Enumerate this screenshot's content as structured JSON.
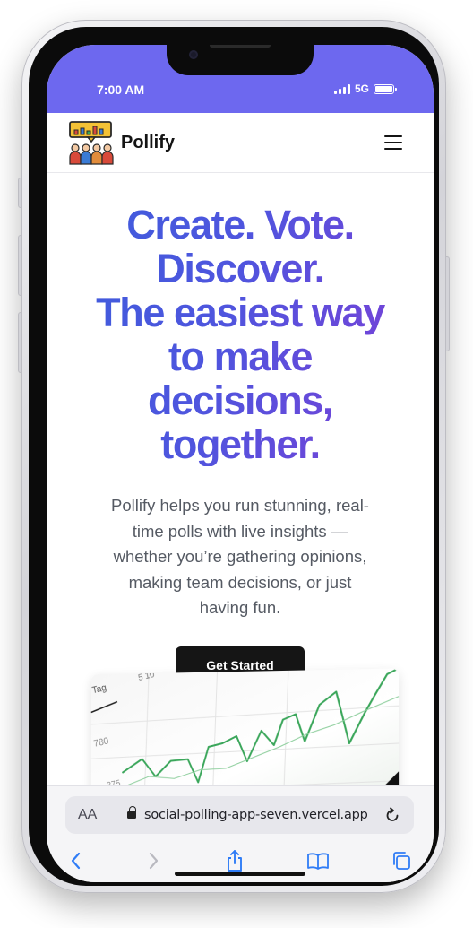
{
  "status_bar": {
    "time": "7:00 AM",
    "network": "5G",
    "signal_bars": 4,
    "battery_level": 1.0,
    "color": "#6d68ef"
  },
  "navbar": {
    "brand": "Pollify",
    "logo_icon": "voters-with-chart-logo",
    "menu_icon": "hamburger-menu-icon"
  },
  "hero": {
    "headline_lines": [
      "Create. Vote.",
      "Discover.",
      "The easiest way",
      "to make",
      "decisions,",
      "together."
    ],
    "description_lines": [
      "Pollify helps you run stunning, real-",
      "time polls with live insights —",
      "whether you’re gathering opinions,",
      "making team decisions, or just",
      "having fun."
    ],
    "cta_label": "Get Started",
    "gradient_colors": [
      "#3d5ddc",
      "#7d3fd6"
    ]
  },
  "preview_image": {
    "labels": [
      "Tag",
      "5 10",
      "780",
      "375"
    ],
    "line_color": "#3aa65a"
  },
  "browser": {
    "text_size_label": "AA",
    "url": "social-polling-app-seven.vercel.app",
    "icons": [
      "back-chevron-icon",
      "forward-chevron-icon",
      "share-icon",
      "bookmarks-icon",
      "tabs-icon",
      "reload-icon",
      "lock-icon"
    ]
  }
}
